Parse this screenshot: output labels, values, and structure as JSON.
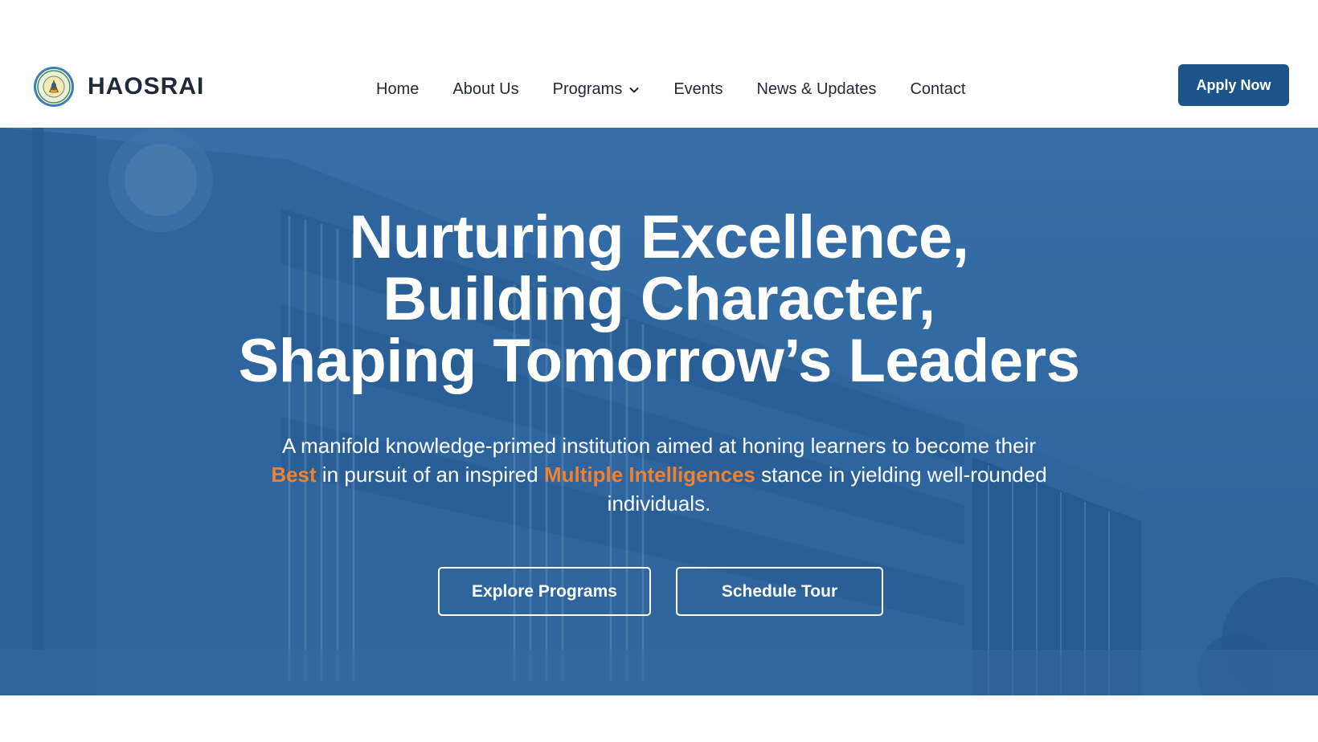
{
  "brand": {
    "name": "HAOSRAI",
    "logo_icon": "school-seal-logo-icon"
  },
  "nav": {
    "items": [
      {
        "label": "Home"
      },
      {
        "label": "About Us"
      },
      {
        "label": "Programs",
        "icon": "chevron-down-icon"
      },
      {
        "label": "Events"
      },
      {
        "label": "News & Updates"
      },
      {
        "label": "Contact"
      }
    ],
    "cta_label": "Apply Now"
  },
  "hero": {
    "title_lines": [
      "Nurturing Excellence,",
      "Building Character,",
      "Shaping Tomorrow’s Leaders"
    ],
    "subtitle": {
      "part1": "A manifold knowledge-primed institution aimed at honing learners to become their ",
      "highlight1": "Best",
      "part2": " in pursuit of an inspired ",
      "highlight2": "Multiple Intelligences",
      "part3": " stance in yielding well-rounded individuals."
    },
    "buttons": {
      "explore_label": "Explore Programs",
      "tour_label": "Schedule Tour"
    },
    "background_image": "school-building-photo"
  },
  "colors": {
    "primary": "#1a5488",
    "accent": "#f2812e",
    "text_dark": "#1f2937",
    "hero_overlay": "#2a609a"
  }
}
